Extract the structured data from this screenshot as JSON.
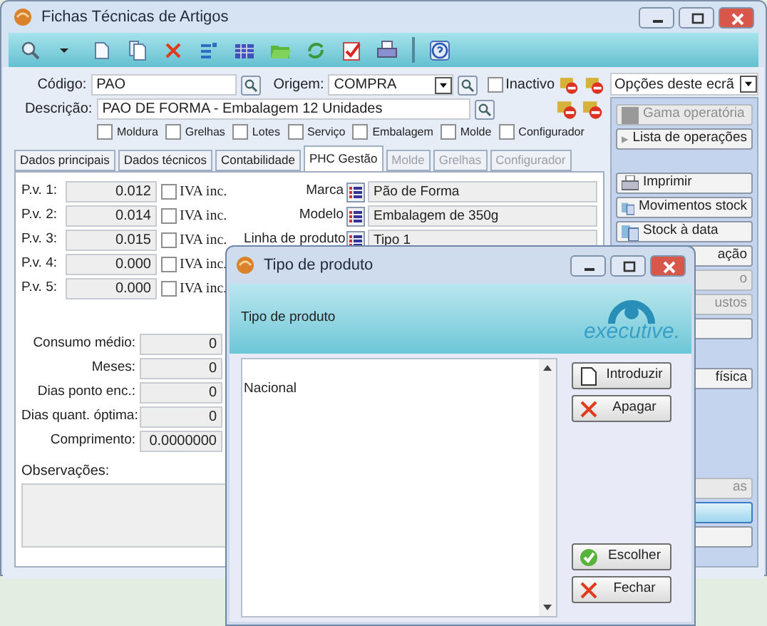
{
  "window": {
    "title": "Fichas Técnicas de Artigos"
  },
  "form": {
    "codigo": {
      "label": "Código:",
      "value": "PAO"
    },
    "origem": {
      "label": "Origem:",
      "value": "COMPRA"
    },
    "inactivo": {
      "label": "Inactivo",
      "checked": false
    },
    "descricao": {
      "label": "Descrição:",
      "value": "PAO DE FORMA - Embalagem 12 Unidades"
    },
    "flags": [
      {
        "label": "Moldura",
        "checked": false
      },
      {
        "label": "Grelhas",
        "checked": false
      },
      {
        "label": "Lotes",
        "checked": false
      },
      {
        "label": "Serviço",
        "checked": false
      },
      {
        "label": "Embalagem",
        "checked": false
      },
      {
        "label": "Molde",
        "checked": false
      },
      {
        "label": "Configurador",
        "checked": false
      }
    ]
  },
  "options_dropdown": {
    "value": "Opções deste ecrã"
  },
  "tabs": [
    {
      "label": "Dados principais",
      "selected": false,
      "disabled": false
    },
    {
      "label": "Dados técnicos",
      "selected": false,
      "disabled": false
    },
    {
      "label": "Contabilidade",
      "selected": false,
      "disabled": false
    },
    {
      "label": "PHC Gestão",
      "selected": true,
      "disabled": false
    },
    {
      "label": "Molde",
      "selected": false,
      "disabled": true
    },
    {
      "label": "Grelhas",
      "selected": false,
      "disabled": true
    },
    {
      "label": "Configurador",
      "selected": false,
      "disabled": true
    }
  ],
  "prices": [
    {
      "label": "P.v. 1:",
      "value": "0.012",
      "iva_label": "IVA inc.",
      "iva_checked": false
    },
    {
      "label": "P.v. 2:",
      "value": "0.014",
      "iva_label": "IVA inc.",
      "iva_checked": false
    },
    {
      "label": "P.v. 3:",
      "value": "0.015",
      "iva_label": "IVA inc.",
      "iva_checked": false
    },
    {
      "label": "P.v. 4:",
      "value": "0.000",
      "iva_label": "IVA inc.",
      "iva_checked": false
    },
    {
      "label": "P.v. 5:",
      "value": "0.000",
      "iva_label": "IVA inc.",
      "iva_checked": false
    }
  ],
  "attributes": [
    {
      "label": "Marca",
      "value": "Pão de Forma"
    },
    {
      "label": "Modelo",
      "value": "Embalagem de 350g"
    },
    {
      "label": "Linha de produto",
      "value": "Tipo 1"
    }
  ],
  "stats": [
    {
      "label": "Consumo médio:",
      "value": "0"
    },
    {
      "label": "Meses:",
      "value": "0"
    },
    {
      "label": "Dias ponto enc.:",
      "value": "0"
    },
    {
      "label": "Dias quant. óptima:",
      "value": "0"
    },
    {
      "label": "Comprimento:",
      "value": "0.0000000"
    }
  ],
  "observacoes": {
    "label": "Observações:"
  },
  "side_action_groups": [
    [
      {
        "label": "Gama operatória",
        "kind": "square",
        "disabled": true,
        "selected": false
      },
      {
        "label": "Lista de operações",
        "kind": "arrow",
        "disabled": false,
        "selected": false
      }
    ],
    [
      {
        "label": "Imprimir",
        "kind": "printer",
        "disabled": false,
        "selected": false
      },
      {
        "label": "Movimentos stock",
        "kind": "docs",
        "disabled": false,
        "selected": false
      },
      {
        "label": "Stock à data",
        "kind": "docs",
        "disabled": false,
        "selected": false
      },
      {
        "label": "ação",
        "kind": "plain",
        "disabled": false,
        "selected": false
      },
      {
        "label": "o",
        "kind": "plain",
        "disabled": true,
        "selected": false
      },
      {
        "label": "ustos",
        "kind": "plain",
        "disabled": true,
        "selected": false
      },
      {
        "kind": "plain",
        "disabled": false,
        "selected": false
      }
    ],
    [
      {
        "label": "física",
        "kind": "plain",
        "disabled": false,
        "selected": false
      }
    ],
    [
      {
        "label": "as",
        "kind": "plain",
        "disabled": true,
        "selected": false
      },
      {
        "kind": "plain",
        "disabled": false,
        "selected": true
      },
      {
        "kind": "plain",
        "disabled": false,
        "selected": false
      }
    ]
  ],
  "dialog": {
    "title": "Tipo de produto",
    "header": "Tipo de produto",
    "logo_text": "executive.",
    "list_items": [
      "Nacional"
    ],
    "buttons": [
      {
        "label": "Introduzir",
        "kind": "new"
      },
      {
        "label": "Apagar",
        "kind": "delete"
      },
      {
        "label": "Escolher",
        "kind": "ok"
      },
      {
        "label": "Fechar",
        "kind": "close"
      }
    ]
  }
}
